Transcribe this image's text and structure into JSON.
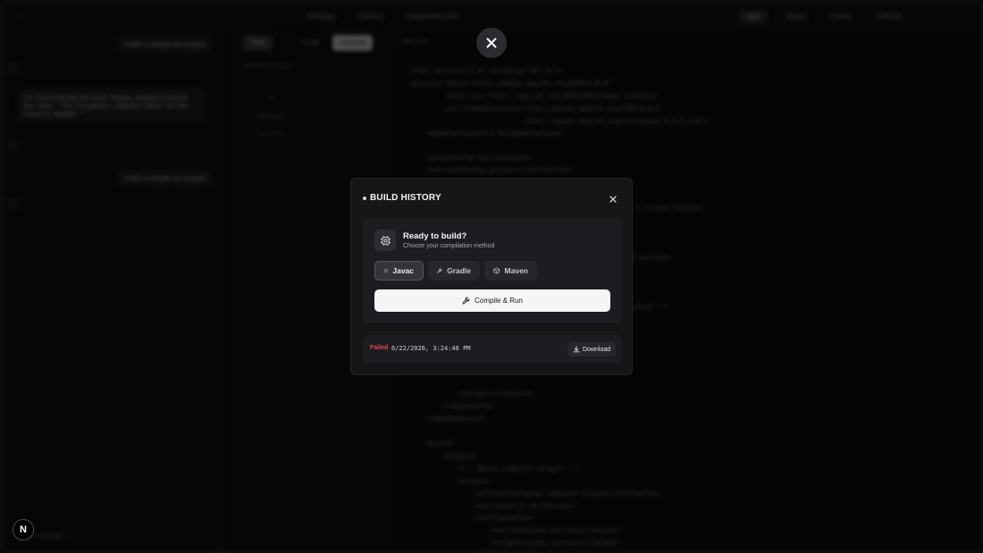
{
  "background": {
    "topbar": {
      "items": [
        "Settings",
        "History",
        "Dependencies"
      ],
      "right_items": [
        "Split",
        "Share",
        "Clone",
        "GitHub"
      ]
    },
    "chat": {
      "messages": [
        "make a simple tax project",
        "I'm encountering this error. Please analyze it and fix the code: * The compilation validation failed. No files found to validate. *",
        "make a simple tax project"
      ],
      "input_placeholder": "Send message..."
    },
    "tree": {
      "tabs": [
        "Files",
        "Code",
        "Console"
      ],
      "header": "PROJECT FILES",
      "items": [
        "src",
        "Main.java",
        "pom.xml"
      ]
    },
    "editor": {
      "filename": "pom.xml",
      "code": [
        "<?xml version=\"1.0\" encoding=\"UTF-8\"?>",
        "<project xmlns=\"http://maven.apache.org/POM/4.0.0\"",
        "         xmlns:xsi=\"http://www.w3.org/2001/XMLSchema-instance\"",
        "         xsi:schemaLocation=\"http://maven.apache.org/POM/4.0.0",
        "                             http://maven.apache.org/xsd/maven-4.0.0.xsd\">",
        "    <modelVersion>4.0.0</modelVersion>",
        "",
        "    <groupId>com.tax</groupId>",
        "    <artifactId>tax-project</artifactId>",
        "",
        "",
        "                                                  Maven 3.x</description>",
        "",
        "",
        "",
        "                                                  nt.api.version>",
        "",
        "",
        "",
        "                                                  ar.handled -->",
        "",
        "",
        "",
        "",
        "",
        "",
        "            </plugin></plugins>",
        "        </dependency>",
        "    </dependencies>",
        "",
        "    <build>",
        "        <plugins>",
        "            <!-- Maven compiler plugin -->",
        "            <plugin>",
        "                <artifactId>maven-compiler-plugin</artifactId>",
        "                <version>3.11.0</version>",
        "                <configuration>",
        "                    <source>${java.version}</source>",
        "                    <target>${java.version}</target>",
        "                </configuration>"
      ]
    }
  },
  "modal": {
    "title": "BUILD HISTORY",
    "card": {
      "title": "Ready to build?",
      "subtitle": "Choose your compilation method",
      "methods": [
        {
          "label": "Javac",
          "icon": "circle-icon",
          "selected": true
        },
        {
          "label": "Gradle",
          "icon": "wrench-icon",
          "selected": false
        },
        {
          "label": "Maven",
          "icon": "package-icon",
          "selected": false
        }
      ],
      "compile_label": "Compile & Run"
    },
    "history": [
      {
        "status": "Failed",
        "timestamp": "6/22/2026, 3:24:46 PM",
        "download_label": "Download"
      }
    ]
  },
  "badge": {
    "letter": "N"
  },
  "colors": {
    "failed": "#e5484d",
    "modal_bg": "#161619",
    "primary_button": "#f5f5f6"
  }
}
